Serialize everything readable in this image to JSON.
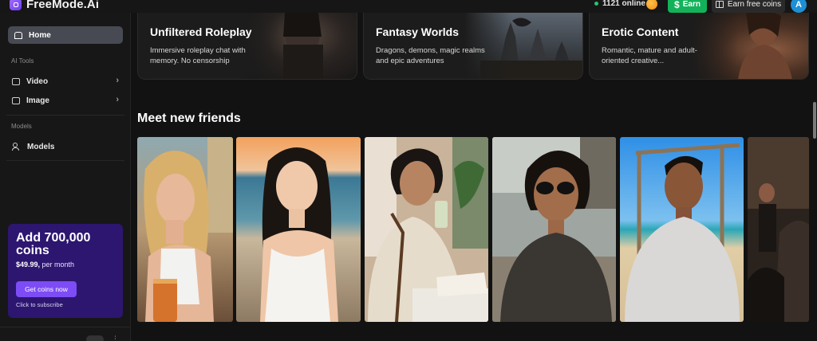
{
  "app": {
    "name": "FreeMode.Ai"
  },
  "header": {
    "online_count": "1121 online",
    "earn_label": "Earn",
    "free_coins_label": "Earn free coins",
    "avatar_initial": "A"
  },
  "sidebar": {
    "home_label": "Home",
    "ai_tools_heading": "AI Tools",
    "tools": [
      {
        "label": "Video",
        "icon": "video-icon"
      },
      {
        "label": "Image",
        "icon": "image-icon"
      }
    ],
    "models_heading": "Models",
    "models_label": "Models",
    "promo": {
      "title": "Add 700,000 coins",
      "price": "$49.99,",
      "period": " per month",
      "button": "Get coins now",
      "subtext": "Click to subscribe"
    }
  },
  "features": [
    {
      "title": "Unfiltered Roleplay",
      "description": "Immersive roleplay chat with memory. No censorship"
    },
    {
      "title": "Fantasy Worlds",
      "description": "Dragons, demons, magic realms and epic adventures"
    },
    {
      "title": "Erotic Content",
      "description": "Romantic, mature and adult-oriented creative..."
    }
  ],
  "friends_section": {
    "title": "Meet new friends",
    "cards": [
      {
        "name": "friend-card-blonde-woman-beach"
      },
      {
        "name": "friend-card-woman-white-dress-sunset"
      },
      {
        "name": "friend-card-man-reading-cafe"
      },
      {
        "name": "friend-card-man-sunglasses"
      },
      {
        "name": "friend-card-man-grey-shirt-beach"
      },
      {
        "name": "friend-card-partial"
      }
    ]
  },
  "colors": {
    "accent_purple": "#7d4cf5",
    "promo_bg": "#2d1670",
    "earn_green": "#13b25a",
    "online_green": "#27c46b",
    "avatar_blue": "#1d8fd6"
  }
}
